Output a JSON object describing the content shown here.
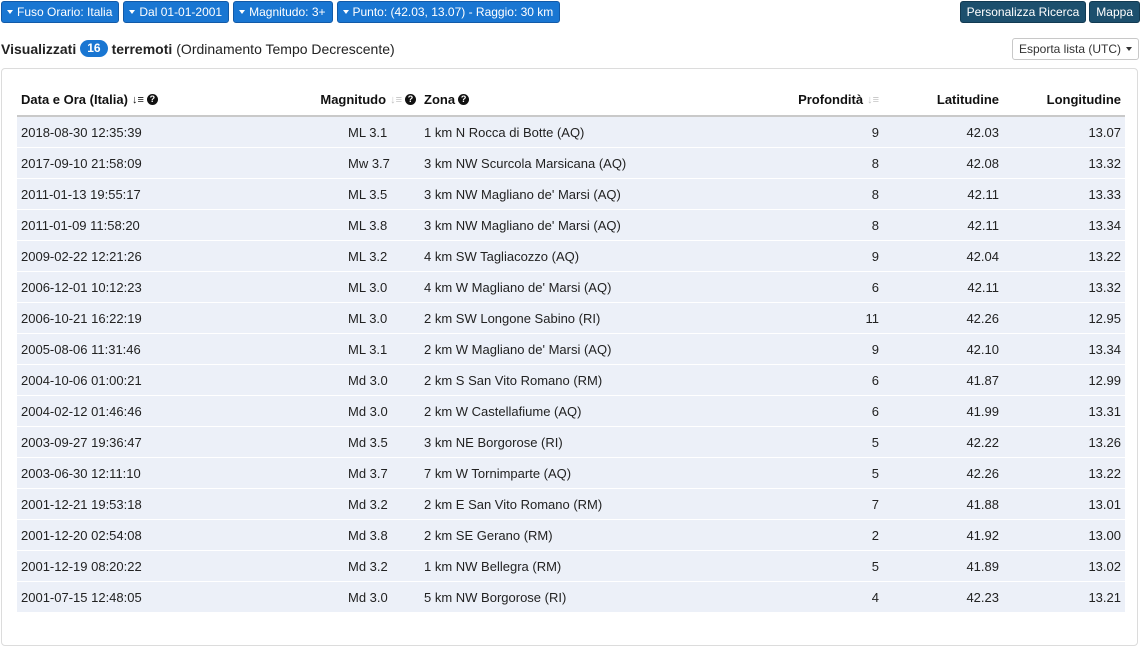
{
  "filters": [
    {
      "label": "Fuso Orario: Italia"
    },
    {
      "label": "Dal 01-01-2001"
    },
    {
      "label": "Magnitudo: 3+"
    },
    {
      "label": "Punto: (42.03, 13.07) - Raggio: 30 km"
    }
  ],
  "toolbar": {
    "customize_label": "Personalizza Ricerca",
    "map_label": "Mappa"
  },
  "summary": {
    "prefix": "Visualizzati",
    "count": "16",
    "noun": "terremoti",
    "order": "(Ordinamento Tempo Decrescente)"
  },
  "export": {
    "label": "Esporta lista (UTC)"
  },
  "table": {
    "headers": {
      "date": "Data e Ora (Italia)",
      "magnitude": "Magnitudo",
      "zone": "Zona",
      "depth": "Profondità",
      "latitude": "Latitudine",
      "longitude": "Longitudine"
    },
    "rows": [
      {
        "date": "2018-08-30 12:35:39",
        "mag": "ML 3.1",
        "zone": "1 km N Rocca di Botte (AQ)",
        "depth": "9",
        "lat": "42.03",
        "lon": "13.07"
      },
      {
        "date": "2017-09-10 21:58:09",
        "mag": "Mw 3.7",
        "zone": "3 km NW Scurcola Marsicana (AQ)",
        "depth": "8",
        "lat": "42.08",
        "lon": "13.32"
      },
      {
        "date": "2011-01-13 19:55:17",
        "mag": "ML 3.5",
        "zone": "3 km NW Magliano de' Marsi (AQ)",
        "depth": "8",
        "lat": "42.11",
        "lon": "13.33"
      },
      {
        "date": "2011-01-09 11:58:20",
        "mag": "ML 3.8",
        "zone": "3 km NW Magliano de' Marsi (AQ)",
        "depth": "8",
        "lat": "42.11",
        "lon": "13.34"
      },
      {
        "date": "2009-02-22 12:21:26",
        "mag": "ML 3.2",
        "zone": "4 km SW Tagliacozzo (AQ)",
        "depth": "9",
        "lat": "42.04",
        "lon": "13.22"
      },
      {
        "date": "2006-12-01 10:12:23",
        "mag": "ML 3.0",
        "zone": "4 km W Magliano de' Marsi (AQ)",
        "depth": "6",
        "lat": "42.11",
        "lon": "13.32"
      },
      {
        "date": "2006-10-21 16:22:19",
        "mag": "ML 3.0",
        "zone": "2 km SW Longone Sabino (RI)",
        "depth": "11",
        "lat": "42.26",
        "lon": "12.95"
      },
      {
        "date": "2005-08-06 11:31:46",
        "mag": "ML 3.1",
        "zone": "2 km W Magliano de' Marsi (AQ)",
        "depth": "9",
        "lat": "42.10",
        "lon": "13.34"
      },
      {
        "date": "2004-10-06 01:00:21",
        "mag": "Md 3.0",
        "zone": "2 km S San Vito Romano (RM)",
        "depth": "6",
        "lat": "41.87",
        "lon": "12.99"
      },
      {
        "date": "2004-02-12 01:46:46",
        "mag": "Md 3.0",
        "zone": "2 km W Castellafiume (AQ)",
        "depth": "6",
        "lat": "41.99",
        "lon": "13.31"
      },
      {
        "date": "2003-09-27 19:36:47",
        "mag": "Md 3.5",
        "zone": "3 km NE Borgorose (RI)",
        "depth": "5",
        "lat": "42.22",
        "lon": "13.26"
      },
      {
        "date": "2003-06-30 12:11:10",
        "mag": "Md 3.7",
        "zone": "7 km W Tornimparte (AQ)",
        "depth": "5",
        "lat": "42.26",
        "lon": "13.22"
      },
      {
        "date": "2001-12-21 19:53:18",
        "mag": "Md 3.2",
        "zone": "2 km E San Vito Romano (RM)",
        "depth": "7",
        "lat": "41.88",
        "lon": "13.01"
      },
      {
        "date": "2001-12-20 02:54:08",
        "mag": "Md 3.8",
        "zone": "2 km SE Gerano (RM)",
        "depth": "2",
        "lat": "41.92",
        "lon": "13.00"
      },
      {
        "date": "2001-12-19 08:20:22",
        "mag": "Md 3.2",
        "zone": "1 km NW Bellegra (RM)",
        "depth": "5",
        "lat": "41.89",
        "lon": "13.02"
      },
      {
        "date": "2001-07-15 12:48:05",
        "mag": "Md 3.0",
        "zone": "5 km NW Borgorose (RI)",
        "depth": "4",
        "lat": "42.23",
        "lon": "13.21"
      }
    ]
  }
}
